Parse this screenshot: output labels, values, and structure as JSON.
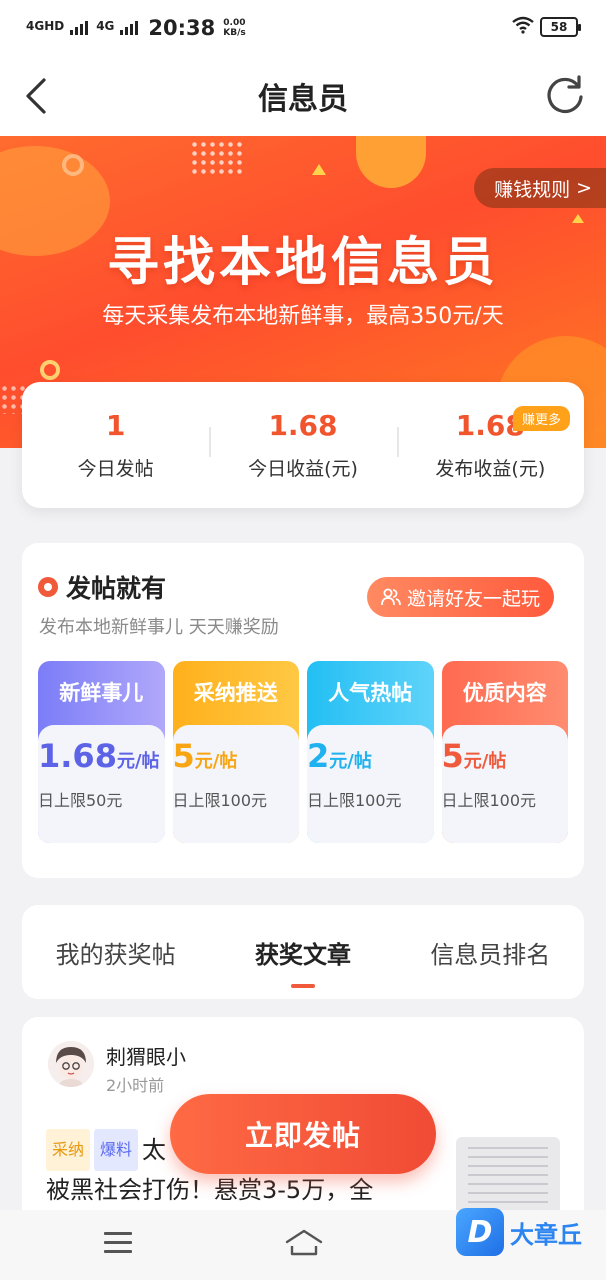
{
  "status_bar": {
    "signal1": "4GHD",
    "signal2": "4G",
    "time": "20:38",
    "speed_value": "0.00",
    "speed_unit": "KB/s",
    "battery": "58"
  },
  "nav": {
    "title": "信息员",
    "back_icon": "back-chevron-icon",
    "refresh_icon": "refresh-icon"
  },
  "hero": {
    "rules_label": "赚钱规则",
    "rules_arrow": ">",
    "title": "寻找本地信息员",
    "subtitle": "每天采集发布本地新鲜事，最高350元/天",
    "colors": {
      "start": "#ff6b2e",
      "end": "#ff7a22"
    }
  },
  "stats": {
    "items": [
      {
        "value": "1",
        "label": "今日发帖"
      },
      {
        "value": "1.68",
        "label": "今日收益(元)"
      },
      {
        "value": "1.68",
        "label": "发布收益(元)"
      }
    ],
    "badge": "赚更多",
    "accent": "#f0552e"
  },
  "post_section": {
    "title": "发帖就有",
    "subtitle": "发布本地新鲜事儿 天天赚奖励",
    "invite_label": "邀请好友一起玩",
    "tiers": [
      {
        "name": "新鲜事儿",
        "price": "1.68",
        "unit": "元/帖",
        "limit": "日上限50元"
      },
      {
        "name": "采纳推送",
        "price": "5",
        "unit": "元/帖",
        "limit": "日上限100元"
      },
      {
        "name": "人气热帖",
        "price": "2",
        "unit": "元/帖",
        "limit": "日上限100元"
      },
      {
        "name": "优质内容",
        "price": "5",
        "unit": "元/帖",
        "limit": "日上限100元"
      }
    ]
  },
  "tabs": [
    {
      "label": "我的获奖帖",
      "active": false
    },
    {
      "label": "获奖文章",
      "active": true
    },
    {
      "label": "信息员排名",
      "active": false
    }
  ],
  "article": {
    "author": "刺猬眼小",
    "time": "2小时前",
    "tag1": "采纳",
    "tag2": "爆料",
    "line1_tail": "太",
    "line2": "被黑社会打伤！悬赏3-5万，全"
  },
  "cta": {
    "label": "立即发帖"
  },
  "watermark": {
    "logo": "D",
    "text": "大章丘"
  }
}
